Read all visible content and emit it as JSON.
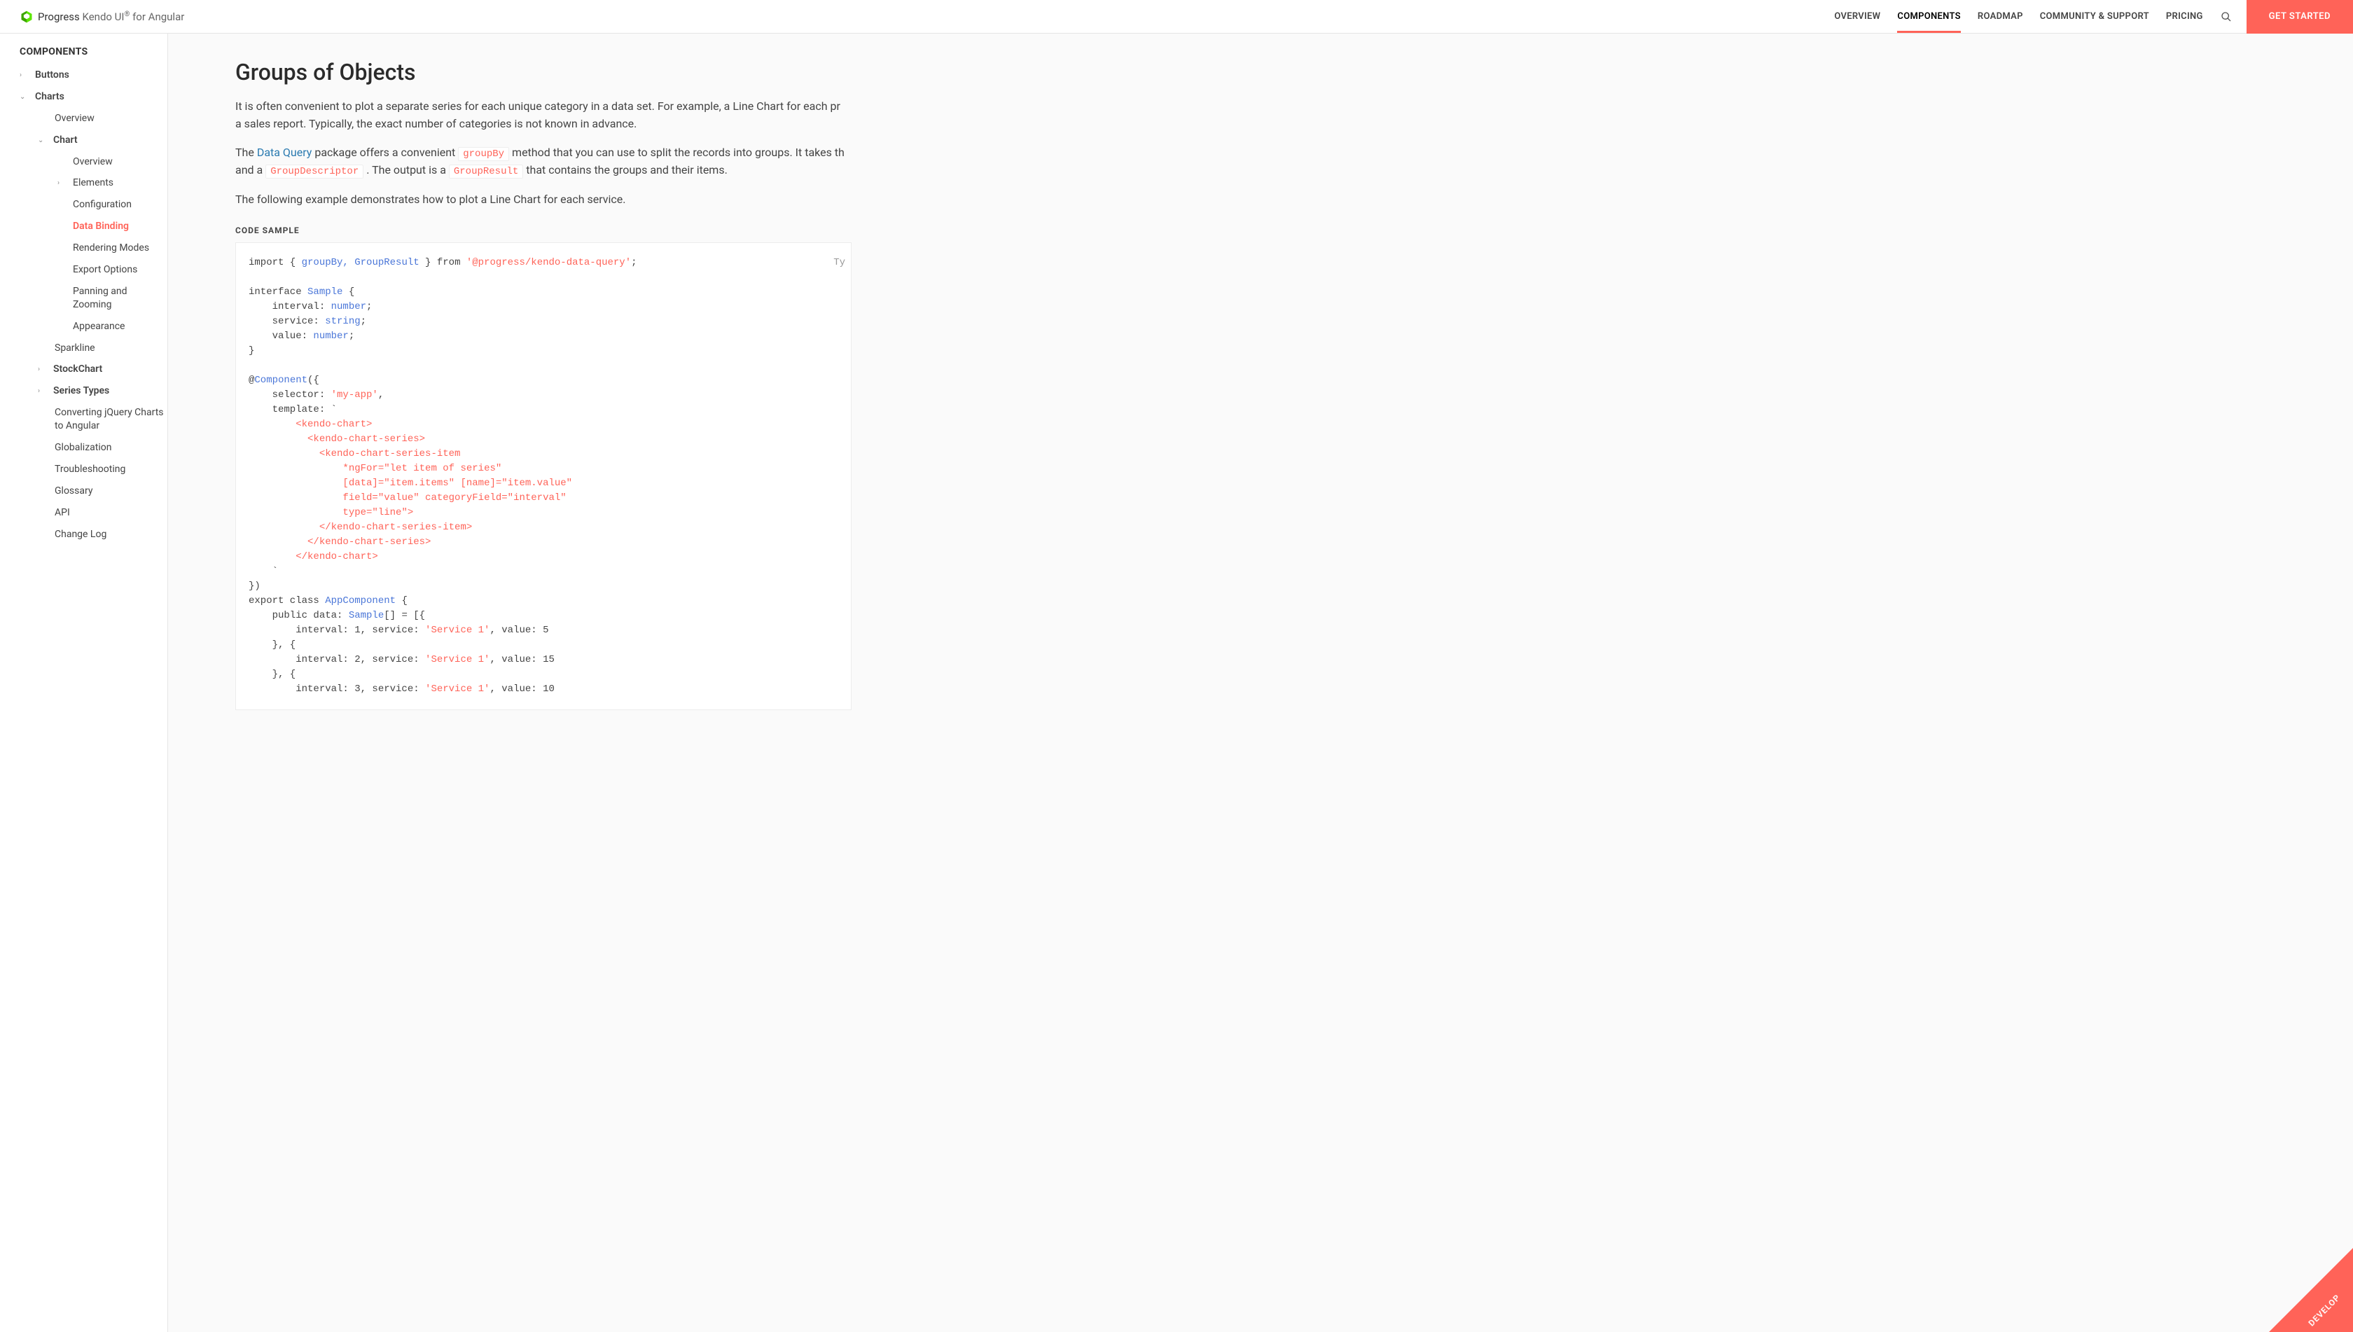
{
  "brand": {
    "name_prefix": "Progress",
    "name_main": " Kendo UI",
    "name_suffix": " for Angular"
  },
  "nav": {
    "items": [
      {
        "label": "OVERVIEW",
        "active": false
      },
      {
        "label": "COMPONENTS",
        "active": true
      },
      {
        "label": "ROADMAP",
        "active": false
      },
      {
        "label": "COMMUNITY & SUPPORT",
        "active": false
      },
      {
        "label": "PRICING",
        "active": false
      }
    ],
    "cta": "GET STARTED"
  },
  "sidebar": {
    "title": "COMPONENTS",
    "tree": [
      {
        "label": "Buttons",
        "depth": 1,
        "chev": "right"
      },
      {
        "label": "Charts",
        "depth": 1,
        "chev": "down"
      },
      {
        "label": "Overview",
        "depth": 2,
        "chev": null,
        "noChev": true
      },
      {
        "label": "Chart",
        "depth": 2,
        "chev": "down"
      },
      {
        "label": "Overview",
        "depth": 3,
        "chev": null
      },
      {
        "label": "Elements",
        "depth": 3,
        "chev": "right",
        "hasChev": true
      },
      {
        "label": "Configuration",
        "depth": 3,
        "chev": null
      },
      {
        "label": "Data Binding",
        "depth": 3,
        "chev": null,
        "active": true
      },
      {
        "label": "Rendering Modes",
        "depth": 3,
        "chev": null
      },
      {
        "label": "Export Options",
        "depth": 3,
        "chev": null
      },
      {
        "label": "Panning and Zooming",
        "depth": 3,
        "chev": null
      },
      {
        "label": "Appearance",
        "depth": 3,
        "chev": null
      },
      {
        "label": "Sparkline",
        "depth": 2,
        "chev": null,
        "noChev": true
      },
      {
        "label": "StockChart",
        "depth": 2,
        "chev": "right"
      },
      {
        "label": "Series Types",
        "depth": 2,
        "chev": "right"
      },
      {
        "label": "Converting jQuery Charts to Angular",
        "depth": 2,
        "chev": null,
        "noChev": true
      },
      {
        "label": "Globalization",
        "depth": 2,
        "chev": null,
        "noChev": true
      },
      {
        "label": "Troubleshooting",
        "depth": 2,
        "chev": null,
        "noChev": true
      },
      {
        "label": "Glossary",
        "depth": 2,
        "chev": null,
        "noChev": true
      },
      {
        "label": "API",
        "depth": 2,
        "chev": null,
        "noChev": true
      },
      {
        "label": "Change Log",
        "depth": 2,
        "chev": null,
        "noChev": true
      }
    ]
  },
  "article": {
    "title": "Groups of Objects",
    "p1": "It is often convenient to plot a separate series for each unique category in a data set. For example, a Line Chart for each pr",
    "p1b": "a sales report. Typically, the exact number of categories is not known in advance.",
    "p2_a": "The ",
    "p2_link": "Data Query",
    "p2_b": " package offers a convenient ",
    "p2_code1": "groupBy",
    "p2_c": " method that you can use to split the records into groups. It takes th",
    "p2_d": "and a ",
    "p2_code2": "GroupDescriptor",
    "p2_e": " . The output is a ",
    "p2_code3": "GroupResult",
    "p2_f": " that contains the groups and their items.",
    "p3": "The following example demonstrates how to plot a Line Chart for each service.",
    "code_label": "CODE SAMPLE",
    "code_lang": "Ty",
    "code": {
      "import_names": "groupBy, GroupResult",
      "import_from": "'@progress/kendo-data-query'",
      "interface_name": "Sample",
      "fields": [
        {
          "name": "interval",
          "type": "number"
        },
        {
          "name": "service",
          "type": "string"
        },
        {
          "name": "value",
          "type": "number"
        }
      ],
      "component_open": "@Component({",
      "selector": "'my-app'",
      "template_lines": [
        "<kendo-chart>",
        "  <kendo-chart-series>",
        "    <kendo-chart-series-item",
        "        *ngFor=\"let item of series\"",
        "        [data]=\"item.items\" [name]=\"item.value\"",
        "        field=\"value\" categoryField=\"interval\"",
        "        type=\"line\">",
        "    </kendo-chart-series-item>",
        "  </kendo-chart-series>",
        "</kendo-chart>"
      ],
      "class_name": "AppComponent",
      "sample_type": "Sample",
      "data_rows": [
        {
          "interval": 1,
          "service": "'Service 1'",
          "value": 5
        },
        {
          "interval": 2,
          "service": "'Service 1'",
          "value": 15
        },
        {
          "interval": 3,
          "service": "'Service 1'",
          "value": 10
        }
      ]
    }
  },
  "corner": "DEVELOP"
}
